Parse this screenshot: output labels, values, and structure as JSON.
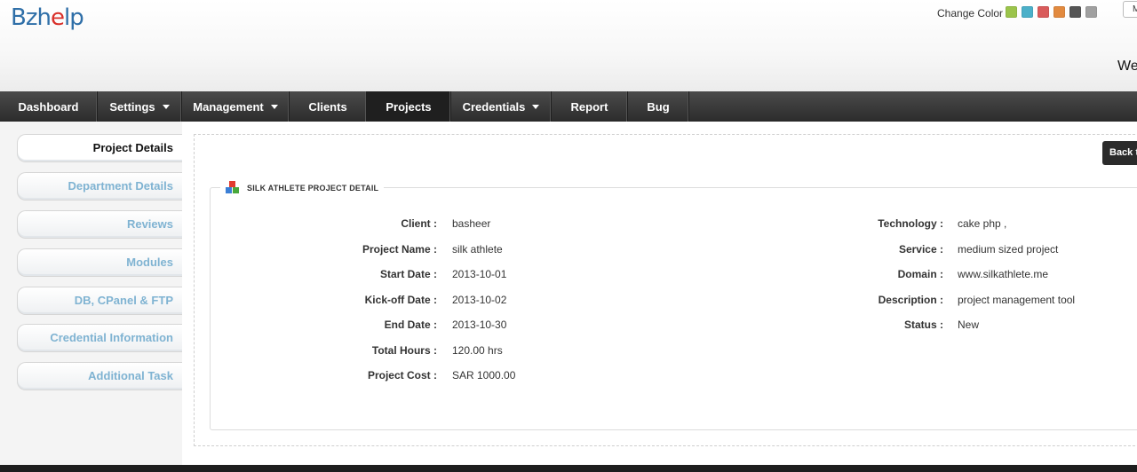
{
  "header": {
    "logo_prefix": "Bzh",
    "logo_accent": "e",
    "logo_suffix": "lp",
    "change_color_label": "Change Color",
    "swatches": [
      "#9bc44b",
      "#4bb0c9",
      "#d95b5b",
      "#e28a3f",
      "#555555",
      "#a0a0a0"
    ],
    "top_button_label": "M",
    "welcome_text": "We"
  },
  "nav": {
    "items": [
      {
        "label": "Dashboard",
        "dropdown": false
      },
      {
        "label": "Settings",
        "dropdown": true
      },
      {
        "label": "Management",
        "dropdown": true
      },
      {
        "label": "Clients",
        "dropdown": false
      },
      {
        "label": "Projects",
        "dropdown": false,
        "active": true
      },
      {
        "label": "Credentials",
        "dropdown": true
      },
      {
        "label": "Report",
        "dropdown": false
      },
      {
        "label": "Bug",
        "dropdown": false
      }
    ]
  },
  "sidebar": {
    "items": [
      {
        "label": "Project Details",
        "active": true
      },
      {
        "label": "Department Details"
      },
      {
        "label": "Reviews"
      },
      {
        "label": "Modules"
      },
      {
        "label": "DB, CPanel & FTP"
      },
      {
        "label": "Credential Information"
      },
      {
        "label": "Additional Task"
      }
    ]
  },
  "main": {
    "back_button_label": "Back t",
    "section_title": "SILK ATHLETE PROJECT DETAIL",
    "left_fields": [
      {
        "label": "Client",
        "value": "basheer"
      },
      {
        "label": "Project Name",
        "value": "silk athlete"
      },
      {
        "label": "Start Date",
        "value": "2013-10-01"
      },
      {
        "label": "Kick-off Date",
        "value": "2013-10-02"
      },
      {
        "label": "End Date",
        "value": "2013-10-30"
      },
      {
        "label": "Total Hours",
        "value": "120.00 hrs"
      },
      {
        "label": "Project Cost",
        "value": "SAR 1000.00"
      }
    ],
    "right_fields": [
      {
        "label": "Technology",
        "value": "cake php ,"
      },
      {
        "label": "Service",
        "value": "medium sized project"
      },
      {
        "label": "Domain",
        "value": "www.silkathlete.me"
      },
      {
        "label": "Description",
        "value": "project management tool"
      },
      {
        "label": "Status",
        "value": "New"
      }
    ]
  }
}
